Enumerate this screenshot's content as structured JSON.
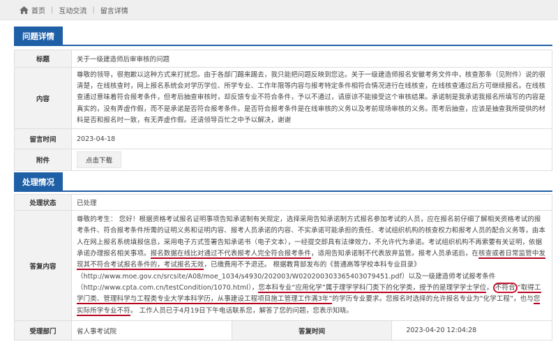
{
  "breadcrumb": {
    "home": "首页",
    "interaction": "互动交流",
    "current": "留言详情"
  },
  "question_section": {
    "title": "问题详情"
  },
  "question": {
    "title_label": "标题",
    "title": "关于一级建造师后审审核的问题",
    "content_label": "内容",
    "content": "尊敬的领导，很抱歉以这种方式来打扰您。由于各部门踢来踢去，我只能把问题反映到您这。关于一级建造师报名安徽考务文件中，核查那条（见附件）说的很清楚，在线核查时，网上报名系统会对学历学位、所学专业、工作年限等内容与报考特定条件相符合情况进行在线核查，在线核查通过后方可继续报名。在线核查通过意味着符合报考条件，但考后抽查审核时，却反馈专业不符合条件，予以不通过，请原谅不能接受这个审核结果。承诺制是我承诺我报名所填写的内容是真实的，没有弄虚作假，而不是承诺是否符合报考条件。是否符合报考条件是在线审核的义务以及考前现场审核的义务。而考后抽查，应该是抽查我所提供的材料是否和报名时一致，有无弄虚作假。还请领导百忙之中予以解决，谢谢",
    "time_label": "留言时间",
    "time": "2023-04-18",
    "attachment_label": "附件",
    "download_label": "点击下载"
  },
  "handling_section": {
    "title": "处理情况"
  },
  "handling": {
    "status_label": "处理状态",
    "status": "已处理",
    "reply_label": "答复内容",
    "reply": {
      "p1": "尊敬的考生：  您好！根据资格考试报名证明事项告知承诺制有关规定，选择采用告知承诺制方式报名参加考试的人员，应在报名前仔细了解相关资格考试的报考条件、符合报考条件所需的证明义务和证明内容、报考人员承诺的内容、不实承诺可能承担的责任、考试组织机构的核查权力和报考人员的配合义务等，由本人在网上报名系统填报信息，采用电子方式签署告知承诺书（电子文本），一经提交即具有法律效力，不允许代为承诺。考试组织机构不再索要有关证明，依据承诺办理报名相关事项。",
      "u1": "报名数据在线比对通过不代表报考人完全符合报考条件",
      "p2": "，适用告知承诺制不代表放弃监管。报考人员承诺后，在",
      "u2": "核查或者日常监管中发现其不符合考试报名条件的，考试报名无效",
      "p3": "，已缴费用不予退还。 根据教育部发布的《普通高等学校本科专业目录》（http://www.moe.gov.cn/srcsite/A08/moe_1034/s4930/202003/W020200303365403079451.pdf）以及一级建造师考试报考条件（http://www.cpta.com.cn/testCondition/1070.html），",
      "u3": "您本科专业“应用化学”属于理学学科门类下的化学类，授予的是理学学士学位",
      "p4": "，",
      "c1": "不符合",
      "u4": "“取得工学门类、管理科学与工程类专业大学本科学历，从事建设工程项目施工管理工作满3年”",
      "p5": "的学历专业要求。您报名时选择的允许报名专业为“化学工程”，也与",
      "u5": "您实际所学专业不符",
      "p6": "。 工作人员已于4月19日下午电话联系您，解答了您的问题，您表示知晓。"
    },
    "dept_label": "受理部门",
    "dept": "省人事考试院",
    "reply_time_label": "答复时间",
    "reply_time": "2023-04-20 12:04:28"
  }
}
